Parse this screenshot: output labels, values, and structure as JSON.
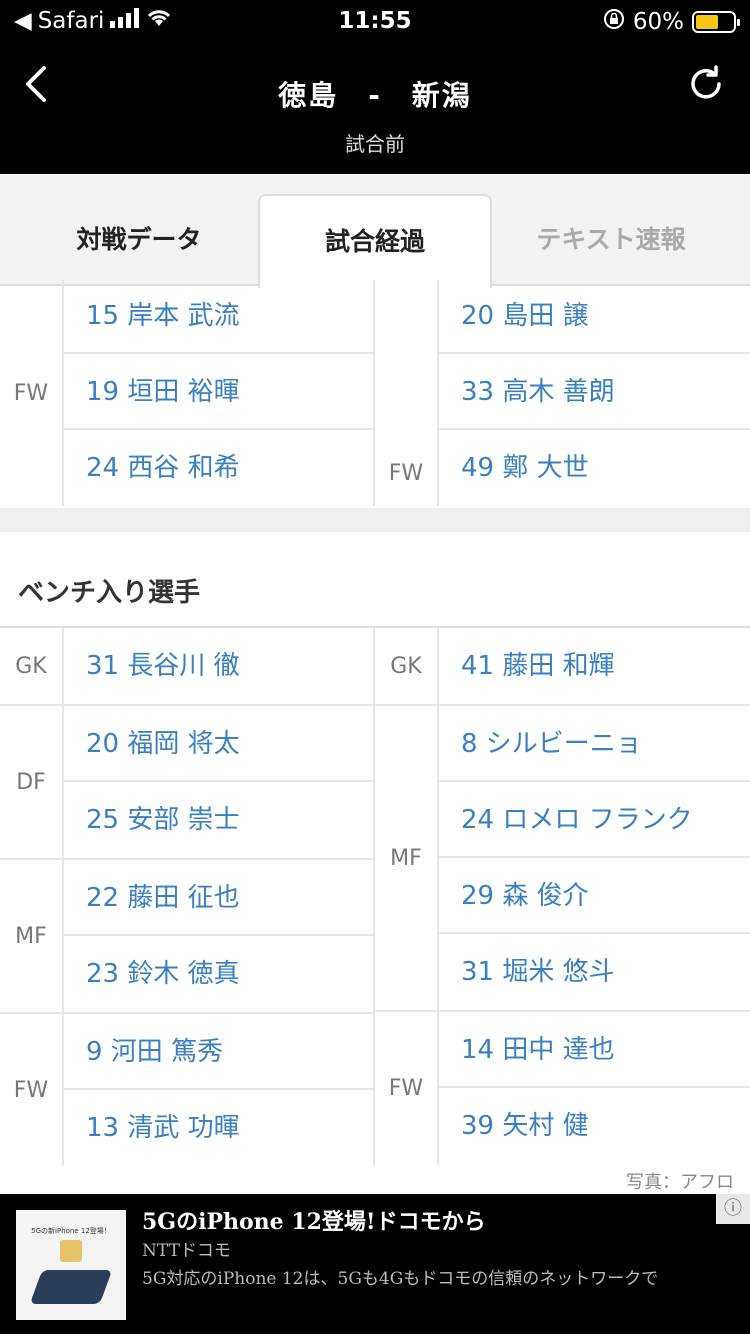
{
  "status_bar": {
    "carrier": "Safari",
    "time": "11:55",
    "battery": "60%"
  },
  "header": {
    "title": "徳島　-　新潟",
    "status": "試合前"
  },
  "tabs": [
    {
      "label": "対戦データ",
      "active": false
    },
    {
      "label": "試合経過",
      "active": true
    },
    {
      "label": "テキスト速報",
      "active": false
    }
  ],
  "starters_tail": {
    "left": {
      "position": "FW",
      "players": [
        "15 岸本 武流",
        "19 垣田 裕暉",
        "24 西谷 和希"
      ]
    },
    "right": {
      "position": "FW",
      "players": [
        "20 島田 譲",
        "33 高木 善朗",
        "49 鄭 大世"
      ]
    }
  },
  "bench": {
    "title": "ベンチ入り選手",
    "left": [
      {
        "position": "GK",
        "players": [
          "31 長谷川 徹"
        ]
      },
      {
        "position": "DF",
        "players": [
          "20 福岡 将太",
          "25 安部 崇士"
        ]
      },
      {
        "position": "MF",
        "players": [
          "22 藤田 征也",
          "23 鈴木 徳真"
        ]
      },
      {
        "position": "FW",
        "players": [
          "9 河田 篤秀",
          "13 清武 功暉"
        ]
      }
    ],
    "right": [
      {
        "position": "GK",
        "players": [
          "41 藤田 和輝"
        ]
      },
      {
        "position": "MF",
        "players": [
          "8 シルビーニョ",
          "24 ロメロ フランク",
          "29 森 俊介",
          "31 堀米 悠斗"
        ]
      },
      {
        "position": "FW",
        "players": [
          "14 田中 達也",
          "39 矢村 健"
        ]
      }
    ]
  },
  "credit": "写真：アフロ",
  "ad": {
    "title": "5GのiPhone 12登場!ドコモから",
    "sponsor": "NTTドコモ",
    "description": "5G対応のiPhone 12は、5Gも4Gもドコモの信頼のネットワークで",
    "thumb_text": "5Gの新iPhone 12登場！"
  },
  "icons": {
    "back": "back-chevron-icon",
    "refresh": "refresh-icon",
    "ad_info": "info-icon"
  }
}
